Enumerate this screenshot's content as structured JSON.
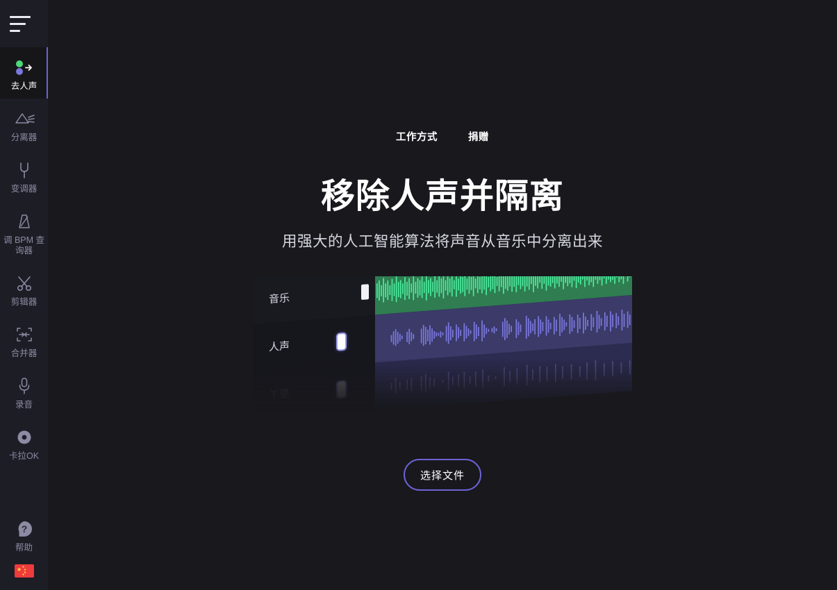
{
  "sidebar": {
    "menu_icon": "hamburger-icon",
    "items": [
      {
        "id": "vocal-remover",
        "label": "去人声",
        "icon": "split-dots-arrow-icon",
        "active": true
      },
      {
        "id": "splitter",
        "label": "分离器",
        "icon": "prism-icon",
        "active": false
      },
      {
        "id": "pitcher",
        "label": "变调器",
        "icon": "tuning-fork-icon",
        "active": false
      },
      {
        "id": "key-bpm-finder",
        "label": "调 BPM 查询器",
        "icon": "metronome-icon",
        "active": false
      },
      {
        "id": "cutter",
        "label": "剪辑器",
        "icon": "scissors-icon",
        "active": false
      },
      {
        "id": "joiner",
        "label": "合并器",
        "icon": "merge-arrows-icon",
        "active": false
      },
      {
        "id": "recorder",
        "label": "录音",
        "icon": "microphone-icon",
        "active": false
      },
      {
        "id": "karaoke",
        "label": "卡拉OK",
        "icon": "record-disc-icon",
        "active": false
      }
    ],
    "help": {
      "id": "help",
      "label": "帮助",
      "icon": "question-mark-icon"
    },
    "language": {
      "id": "language",
      "label": "中文",
      "icon": "flag-cn-icon"
    }
  },
  "topnav": {
    "links": [
      {
        "id": "how-it-works",
        "label": "工作方式"
      },
      {
        "id": "donate",
        "label": "捐赠"
      }
    ]
  },
  "hero": {
    "title": "移除人声并隔离",
    "subtitle": "用强大的人工智能算法将声音从音乐中分离出来"
  },
  "illustration": {
    "tracks": [
      {
        "id": "music",
        "label": "音乐",
        "slider_position": "right",
        "wave_color": "#4cf0a0",
        "track_color": "#2f7d51"
      },
      {
        "id": "vocals",
        "label": "人声",
        "slider_position": "mid",
        "wave_color": "#7a78dd",
        "track_color": "#3b3a68"
      },
      {
        "id": "other",
        "label": "丫里",
        "slider_position": "mid",
        "wave_color": "#504e86",
        "track_color": "#2c2b50"
      }
    ]
  },
  "actions": {
    "select_file_label": "选择文件"
  },
  "colors": {
    "accent": "#6c63d6",
    "background": "#18181d",
    "sidebar_background": "#1d1d26",
    "music_green": "#4cf0a0",
    "vocal_purple": "#7a78dd",
    "flag_red": "#ee3b3b"
  }
}
